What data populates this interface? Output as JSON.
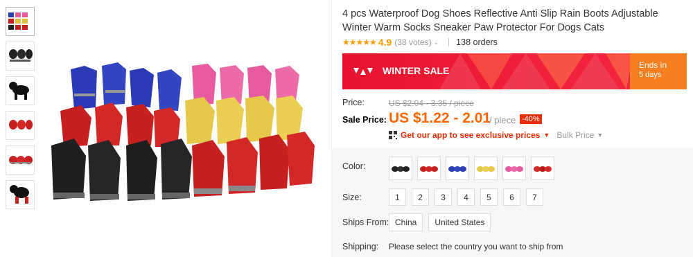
{
  "product": {
    "title": "4 pcs Waterproof Dog Shoes Reflective Anti Slip Rain Boots Adjustable Winter Warm Socks Sneaker Paw Protector For Dogs Cats",
    "stars": "★★★★★",
    "rating": "4.9",
    "votes": "(38 votes)",
    "orders": "138 orders"
  },
  "banner": {
    "label": "WINTER SALE",
    "ends_in": "Ends in",
    "days": "5 days"
  },
  "price": {
    "label": "Price:",
    "original": "US $2.04 - 3.35 / piece",
    "sale_label": "Sale Price:",
    "sale": "US $1.22 - 2.01",
    "per_piece": "/ piece",
    "discount": "-40%",
    "app_link": "Get our app to see exclusive prices",
    "bulk": "Bulk Price"
  },
  "options": {
    "color_label": "Color:",
    "colors": [
      "black",
      "red",
      "blue",
      "yellow",
      "pink",
      "red-alt"
    ],
    "size_label": "Size:",
    "sizes": [
      "1",
      "2",
      "3",
      "4",
      "5",
      "6",
      "7"
    ],
    "ships_label": "Ships From:",
    "ships_from": [
      "China",
      "United States"
    ],
    "shipping_label": "Shipping:",
    "shipping_text": "Please select the country you want to ship from"
  },
  "colors": {
    "sale_red": "#e8122d",
    "price_orange": "#ff6600",
    "star": "#ff9900",
    "banner_orange": "#f77f1f"
  }
}
